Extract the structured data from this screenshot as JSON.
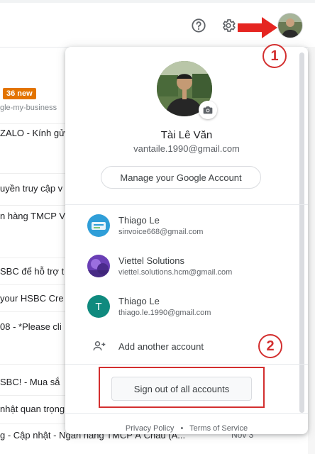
{
  "header": {
    "help_icon": "help-circle-icon",
    "settings_icon": "gear-icon"
  },
  "background_list": {
    "badge": "36 new",
    "rows": [
      "gle-my-business",
      "ZALO - Kính gửi",
      "uyền truy cập v",
      "n hàng TMCP V",
      "SBC để hỗ trợ t",
      "your HSBC Cre",
      "08 - *Please cli",
      "SBC! - Mua sắ",
      "nhật quan trọng"
    ],
    "bottom_row": "g - Cập nhật - Ngân hàng TMCP Á Châu (A...",
    "bottom_date": "Nov 3"
  },
  "account": {
    "name": "Tài Lê Văn",
    "email": "vantaile.1990@gmail.com",
    "manage_label": "Manage your Google Account"
  },
  "other_accounts": [
    {
      "name": "Thiago Le",
      "email": "sinvoice668@gmail.com"
    },
    {
      "name": "Viettel Solutions",
      "email": "viettel.solutions.hcm@gmail.com"
    },
    {
      "name": "Thiago Le",
      "email": "thiago.le.1990@gmail.com",
      "initial": "T"
    }
  ],
  "add_account_label": "Add another account",
  "signout_label": "Sign out of all accounts",
  "footer": {
    "privacy": "Privacy Policy",
    "separator": "•",
    "terms": "Terms of Service"
  },
  "annotations": {
    "step1": "1",
    "step2": "2",
    "color": "#d32f2f"
  },
  "colors": {
    "teal_avatar": "#0f8a7e",
    "badge": "#e37400"
  }
}
